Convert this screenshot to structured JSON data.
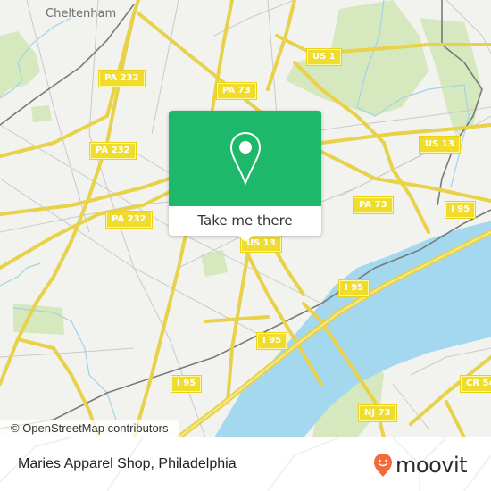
{
  "map": {
    "place_labels": [
      {
        "text": "Cheltenham"
      }
    ],
    "shields": [
      {
        "text": "PA 232"
      },
      {
        "text": "PA 232"
      },
      {
        "text": "PA 232"
      },
      {
        "text": "PA 73"
      },
      {
        "text": "US 1"
      },
      {
        "text": "US 13"
      },
      {
        "text": "PA 73"
      },
      {
        "text": "US 13"
      },
      {
        "text": "I 95"
      },
      {
        "text": "I 95"
      },
      {
        "text": "I 95"
      },
      {
        "text": "I 95"
      },
      {
        "text": "NJ 73"
      },
      {
        "text": "CR 54"
      }
    ],
    "attribution": "© OpenStreetMap contributors",
    "colors": {
      "land": "#f2f2ef",
      "water": "#a3d8ee",
      "park": "#cfe5b0",
      "road_major": "#f5e46a",
      "road_minor": "#c8c8c8",
      "rail": "#777777"
    }
  },
  "popup": {
    "icon": "location-pin-icon",
    "button_label": "Take me there",
    "accent": "#1db86a"
  },
  "footer": {
    "place_name": "Maries Apparel Shop, Philadelphia",
    "brand": {
      "icon": "moovit-smile-pin-icon",
      "word": "moovit",
      "accent": "#f26a3b"
    }
  }
}
